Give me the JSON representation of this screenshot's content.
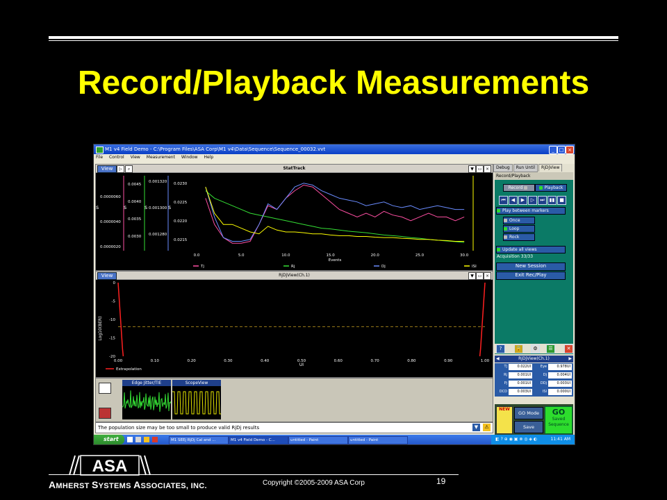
{
  "slide": {
    "title": "Record/Playback Measurements",
    "copyright": "Copyright ©2005-2009 ASA Corp",
    "page_number": "19",
    "company_parts": [
      "A",
      "MHERST ",
      "S",
      "YSTEMS ",
      "A",
      "SSOCIATES, INC."
    ],
    "logo_text": "ASA"
  },
  "window": {
    "title": "M1 v4 Field Demo - C:\\Program Files\\ASA Corp\\M1 v4\\Data\\Sequence\\Sequence_00032.vvt",
    "menu": [
      "File",
      "Control",
      "View",
      "Measurement",
      "Window",
      "Help"
    ]
  },
  "stattrack": {
    "view_label": "View",
    "title": "StatTrack",
    "xlabel": "Events",
    "y_axes": [
      {
        "ticks": [
          "0.0000060",
          "0.0000040",
          "0.0000020"
        ]
      },
      {
        "ticks": [
          "0.0045",
          "0.0040",
          "0.0035",
          "0.0030"
        ]
      },
      {
        "ticks": [
          "0.001320",
          "0.001300",
          "0.001280"
        ]
      },
      {
        "ticks": [
          "0.0230",
          "0.0225",
          "0.0220",
          "0.0215"
        ]
      }
    ],
    "unit_glyph": "s"
  },
  "rjdj": {
    "view_label": "View",
    "title": "RjDjView(Ch.1)",
    "ylabel": "Log10(BER)",
    "xlabel": "UI",
    "legend": "Extrapolation"
  },
  "bottom": {
    "edge_title": "Edge Jitter/TIE",
    "scope_title": "ScopeView",
    "status_message": "The population size may be too small to produce valid RjDj results"
  },
  "sidebar": {
    "tabs": [
      "Debug",
      "Run Until",
      "RjDjView"
    ],
    "panel_title": "Record/Playback",
    "record": "Record",
    "playback": "Playback",
    "play_between": "Play between markers",
    "once": "Once",
    "loop": "Loop",
    "rock": "Rock",
    "update_all": "Update all views",
    "acquisition": "Acquisition 33/33",
    "new_session": "New Session",
    "exit_rec": "Exit Rec/Play",
    "rjdj_ch": "RjDjView(Ch.1)",
    "metrics_left": [
      {
        "label": "Tj",
        "value": "0.022UI"
      },
      {
        "label": "Rj",
        "value": "0.001UI"
      },
      {
        "label": "Pj",
        "value": "0.001UI"
      },
      {
        "label": "DCD",
        "value": "0.003UI"
      }
    ],
    "metrics_right": [
      {
        "label": "Eye",
        "value": "0.978UI"
      },
      {
        "label": "Dj",
        "value": "0.004UI"
      },
      {
        "label": "DDj",
        "value": "0.003UI"
      },
      {
        "label": "ISI",
        "value": "0.000UI"
      }
    ],
    "new_label": "NEW",
    "go_mode": "GO Mode",
    "save": "Save",
    "go_title": "GO",
    "go_sub1": "Saved",
    "go_sub2": "Sequence"
  },
  "taskbar": {
    "start": "start",
    "items": [
      "M1 SEEj RjDj Cal and ...",
      "M1 v4 Field Demo - C...",
      "untitled - Paint",
      "untitled - Paint"
    ],
    "clock": "11:41 AM"
  },
  "chart_data": [
    {
      "type": "line",
      "title": "StatTrack",
      "xlabel": "Events",
      "xlim": [
        0,
        31
      ],
      "x_ticks": [
        "0.0",
        "5.0",
        "10.0",
        "15.0",
        "20.0",
        "25.0",
        "30.0"
      ],
      "ylim": [
        0.0212,
        0.0232
      ],
      "y_ticks": [
        "0.0230",
        "0.0225",
        "0.0220",
        "0.0215"
      ],
      "legend_position": "bottom",
      "x": [
        1,
        2,
        3,
        4,
        5,
        6,
        7,
        8,
        9,
        10,
        11,
        12,
        13,
        14,
        15,
        16,
        17,
        18,
        19,
        20,
        21,
        22,
        23,
        24,
        25,
        26,
        27,
        28,
        29,
        30
      ],
      "series": [
        {
          "name": "Tj",
          "color": "#ff4fa3",
          "values": [
            0.0226,
            0.0219,
            0.02155,
            0.0214,
            0.0214,
            0.02145,
            0.0219,
            0.0224,
            0.0223,
            0.0226,
            0.0228,
            0.02295,
            0.0229,
            0.0227,
            0.0225,
            0.0223,
            0.0222,
            0.0221,
            0.0222,
            0.0221,
            0.02225,
            0.02215,
            0.0221,
            0.022,
            0.0221,
            0.0222,
            0.0221,
            0.0221,
            0.022,
            0.0221
          ]
        },
        {
          "name": "Rj",
          "color": "#35e035",
          "values": [
            0.0228,
            0.0226,
            0.0225,
            0.0224,
            0.0223,
            0.0222,
            0.02215,
            0.0221,
            0.02205,
            0.022,
            0.02195,
            0.0219,
            0.02185,
            0.0218,
            0.02178,
            0.02175,
            0.02172,
            0.0217,
            0.02168,
            0.02165,
            0.02162,
            0.0216,
            0.02158,
            0.02155,
            0.02153,
            0.0215,
            0.02148,
            0.02146,
            0.02144,
            0.02142
          ]
        },
        {
          "name": "Dj",
          "color": "#6a8cff",
          "values": [
            0.0229,
            0.0221,
            0.02155,
            0.02145,
            0.02145,
            0.0215,
            0.0219,
            0.02245,
            0.0223,
            0.0226,
            0.0229,
            0.023,
            0.02295,
            0.0228,
            0.0227,
            0.0226,
            0.02255,
            0.0225,
            0.0224,
            0.02245,
            0.0225,
            0.0224,
            0.02235,
            0.0224,
            0.0223,
            0.02235,
            0.0224,
            0.02235,
            0.0223,
            0.0223
          ]
        },
        {
          "name": "ISI",
          "color": "#ffff00",
          "values": [
            0.0229,
            0.0222,
            0.0219,
            0.0219,
            0.0218,
            0.0217,
            0.02165,
            0.02185,
            0.02175,
            0.0217,
            0.0217,
            0.02168,
            0.02165,
            0.02165,
            0.02162,
            0.0216,
            0.0216,
            0.02158,
            0.02158,
            0.02156,
            0.02155,
            0.02155,
            0.02153,
            0.02152,
            0.0215,
            0.0215,
            0.02148,
            0.02147,
            0.02145,
            0.02145
          ]
        }
      ]
    },
    {
      "type": "line",
      "title": "RjDjView(Ch.1)",
      "xlabel": "UI",
      "ylabel": "Log10(BER)",
      "xlim": [
        0,
        1
      ],
      "ylim": [
        -20,
        0
      ],
      "x_ticks": [
        "0.00",
        "0.10",
        "0.20",
        "0.30",
        "0.40",
        "0.50",
        "0.60",
        "0.70",
        "0.80",
        "0.90",
        "1.00"
      ],
      "y_ticks": [
        "0",
        "-5",
        "-10",
        "-15",
        "-20"
      ],
      "legend_position": "bottom-left",
      "reference_level": -12,
      "series": [
        {
          "name": "Extrapolation",
          "color": "#ff2020",
          "x": [
            0.0,
            0.002,
            0.004,
            0.006,
            0.008,
            0.01,
            0.012,
            0.014
          ],
          "values": [
            0,
            -3,
            -6,
            -9,
            -12,
            -15,
            -18,
            -20
          ]
        },
        {
          "name": "Extrapolation (right)",
          "color": "#ff2020",
          "x": [
            1.0,
            0.998,
            0.996,
            0.994,
            0.992,
            0.99,
            0.988,
            0.986
          ],
          "values": [
            0,
            -3,
            -6,
            -9,
            -12,
            -15,
            -18,
            -20
          ]
        }
      ]
    }
  ]
}
